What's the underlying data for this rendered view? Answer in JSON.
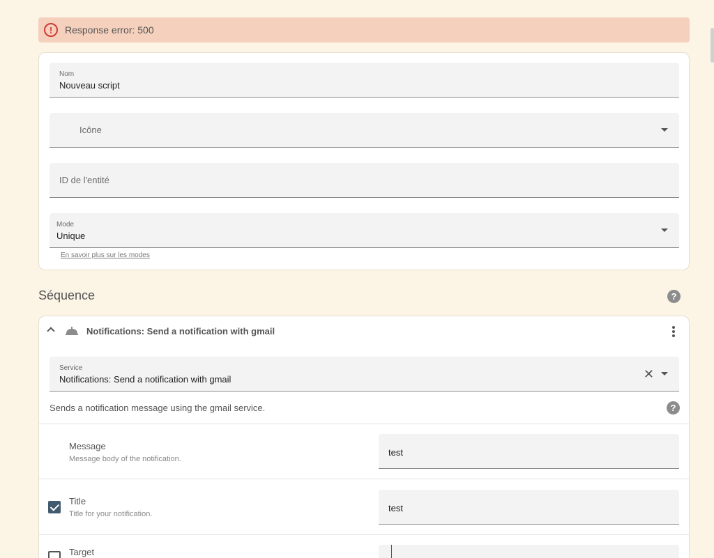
{
  "error": {
    "text": "Response error: 500"
  },
  "form": {
    "name": {
      "label": "Nom",
      "value": "Nouveau script"
    },
    "icon": {
      "placeholder": "Icône"
    },
    "entity_id": {
      "placeholder": "ID de l'entité"
    },
    "mode": {
      "label": "Mode",
      "value": "Unique",
      "helper": "En savoir plus sur les modes"
    }
  },
  "sequence": {
    "title": "Séquence",
    "action": {
      "title": "Notifications: Send a notification with gmail",
      "service": {
        "label": "Service",
        "value": "Notifications: Send a notification with gmail"
      },
      "description": "Sends a notification message using the gmail service.",
      "params": [
        {
          "name": "Message",
          "desc": "Message body of the notification.",
          "value": "test",
          "checkbox": false
        },
        {
          "name": "Title",
          "desc": "Title for your notification.",
          "value": "test",
          "checkbox": true,
          "checked": true
        },
        {
          "name": "Target",
          "desc": "",
          "value": "",
          "checkbox": true,
          "checked": false
        }
      ]
    }
  },
  "colors": {
    "background": "#fcf5e6",
    "error_bg": "#f5d0bd",
    "error_icon": "#d23a35",
    "checkbox_checked": "#415a6e"
  },
  "icons": [
    "alert-circle-icon",
    "chevron-down-icon",
    "help-circle-icon",
    "chevron-up-icon",
    "bell-icon",
    "kebab-icon",
    "close-icon"
  ]
}
